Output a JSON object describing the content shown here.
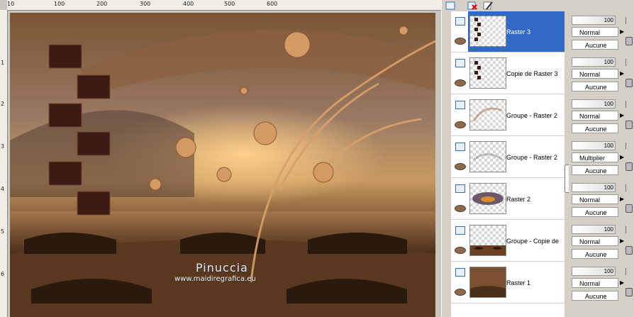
{
  "ruler": {
    "top_ticks": [
      "10",
      "100",
      "200",
      "300",
      "400",
      "500",
      "600"
    ],
    "left_ticks": [
      "1",
      "2",
      "3",
      "4",
      "5",
      "6"
    ]
  },
  "artwork": {
    "title": "Pinuccia",
    "url": "www.maidiregrafica.eu"
  },
  "layers": [
    {
      "name": "Raster 3",
      "selected": true,
      "opacity": "100",
      "blend": "Normal",
      "mask": "Aucune"
    },
    {
      "name": "Copie de Raster 3",
      "selected": false,
      "opacity": "100",
      "blend": "Normal",
      "mask": "Aucune"
    },
    {
      "name": "Groupe - Raster 2",
      "selected": false,
      "opacity": "100",
      "blend": "Normal",
      "mask": "Aucune"
    },
    {
      "name": "Groupe - Raster 2",
      "selected": false,
      "opacity": "100",
      "blend": "Multiplier",
      "mask": "Aucune"
    },
    {
      "name": "Raster 2",
      "selected": false,
      "opacity": "100",
      "blend": "Normal",
      "mask": "Aucune"
    },
    {
      "name": "Groupe - Copie de",
      "selected": false,
      "opacity": "100",
      "blend": "Normal",
      "mask": "Aucune"
    },
    {
      "name": "Raster 1",
      "selected": false,
      "opacity": "100",
      "blend": "Normal",
      "mask": "Aucune"
    }
  ],
  "colors": {
    "selection": "#316ac5",
    "panel": "#d4d0c8",
    "art_brown": "#6b4a2c"
  }
}
